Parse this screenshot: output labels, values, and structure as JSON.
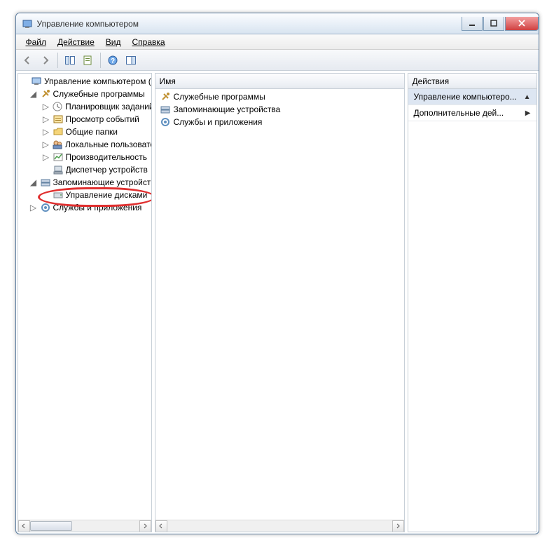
{
  "window": {
    "title": "Управление компьютером"
  },
  "menu": {
    "file": "Файл",
    "action": "Действие",
    "view": "Вид",
    "help": "Справка"
  },
  "tree": {
    "root": "Управление компьютером (л",
    "utilities": "Служебные программы",
    "task_scheduler": "Планировщик заданий",
    "event_viewer": "Просмотр событий",
    "shared_folders": "Общие папки",
    "local_users": "Локальные пользовате",
    "performance": "Производительность",
    "device_manager": "Диспетчер устройств",
    "storage": "Запоминающие устройст",
    "disk_mgmt": "Управление дисками",
    "services_apps": "Службы и приложения"
  },
  "main": {
    "header": "Имя",
    "items": {
      "utilities": "Служебные программы",
      "storage": "Запоминающие устройства",
      "services_apps": "Службы и приложения"
    }
  },
  "actions": {
    "header": "Действия",
    "primary": "Управление компьютеро...",
    "more": "Дополнительные дей..."
  }
}
